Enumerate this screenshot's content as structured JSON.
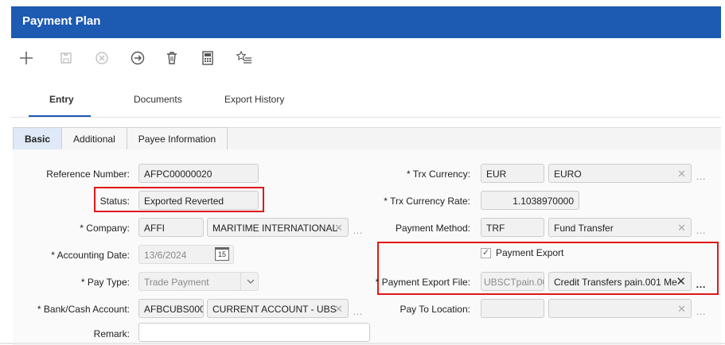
{
  "window": {
    "title": "Payment Plan"
  },
  "toolbar": {
    "icons": [
      "add-icon",
      "save-icon",
      "cancel-icon",
      "navigate-icon",
      "delete-icon",
      "calculator-icon",
      "favorite-list-icon"
    ]
  },
  "main_tabs": [
    "Entry",
    "Documents",
    "Export History"
  ],
  "sub_tabs": [
    "Basic",
    "Additional",
    "Payee Information"
  ],
  "form": {
    "reference_number": {
      "label": "Reference Number:",
      "value": "AFPC00000020"
    },
    "status": {
      "label": "Status:",
      "value": "Exported Reverted"
    },
    "company": {
      "label": "* Company:",
      "code": "AFFI",
      "name": "MARITIME INTERNATIONAL"
    },
    "accounting_date": {
      "label": "* Accounting Date:",
      "value": "13/6/2024",
      "calendar_day": "15"
    },
    "pay_type": {
      "label": "* Pay Type:",
      "value": "Trade Payment"
    },
    "bank_cash_account": {
      "label": "* Bank/Cash Account:",
      "code": "AFBCUBS000(",
      "name": "CURRENT ACCOUNT - UBS"
    },
    "remark": {
      "label": "Remark:",
      "value": ""
    },
    "trx_currency": {
      "label": "* Trx Currency:",
      "code": "EUR",
      "name": "EURO"
    },
    "trx_currency_rate": {
      "label": "* Trx Currency Rate:",
      "value": "1.1038970000"
    },
    "payment_method": {
      "label": "Payment Method:",
      "code": "TRF",
      "name": "Fund Transfer"
    },
    "payment_export": {
      "label": "Payment Export",
      "checked": true
    },
    "payment_export_file": {
      "label": "* Payment Export File:",
      "code": "UBSCTpain.00",
      "name": "Credit Transfers pain.001 Me"
    },
    "pay_to_location": {
      "label": "Pay To Location:",
      "code": "",
      "name": ""
    }
  },
  "colors": {
    "header": "#1d5ab2",
    "highlight": "#e01818"
  }
}
